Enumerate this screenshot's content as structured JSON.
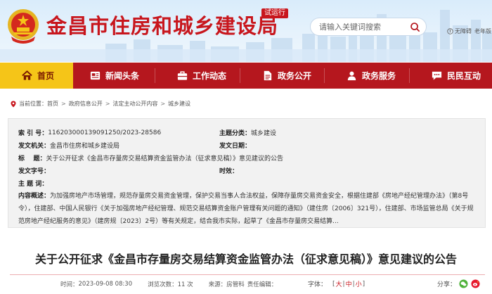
{
  "header": {
    "site_title": "金昌市住房和城乡建设局",
    "trial_badge": "试运行",
    "search_placeholder": "请输入关键词搜索",
    "accessibility_label": "无障碍",
    "old_version_label": "老年版"
  },
  "nav": {
    "items": [
      {
        "label": "首页",
        "active": true,
        "icon": "home-icon"
      },
      {
        "label": "新闻头条",
        "active": false,
        "icon": "news-icon"
      },
      {
        "label": "工作动态",
        "active": false,
        "icon": "briefcase-icon"
      },
      {
        "label": "政务公开",
        "active": false,
        "icon": "document-icon"
      },
      {
        "label": "政务服务",
        "active": false,
        "icon": "service-icon"
      },
      {
        "label": "民民互动",
        "active": false,
        "icon": "chat-icon"
      }
    ]
  },
  "breadcrumb": {
    "location_label": "当前位置：",
    "items": [
      "首页",
      "政府信息公开",
      "法定主动公开内容",
      "城乡建设"
    ]
  },
  "info": {
    "index_label": "索 引 号：",
    "index_value": "116203000139091250/2023-28586",
    "topic_label": "主题分类：",
    "topic_value": "城乡建设",
    "issuer_label": "发文机关：",
    "issuer_value": "金昌市住房和城乡建设局",
    "issue_date_label": "发文日期：",
    "issue_date_value": "",
    "title_label": "标    题：",
    "title_value": "关于公开征求《金昌市存量房交易结算资金监管办法（征求意见稿）》意见建议的公告",
    "doc_no_label": "发文字号：",
    "doc_no_value": "",
    "validity_label": "时效：",
    "validity_value": "",
    "keywords_label": "主 题 词：",
    "keywords_value": "",
    "summary_label": "内容概述：",
    "summary_value": "为加强房地产市场管理，规范存量房交易资金管理，保护交易当事人合法权益，保障存量房交易资金安全，根据住建部《房地产经纪管理办法》（第8号令），住建部、中国人民银行《关于加强房地产经纪管理、规范交易结算资金账户管理有关问题的通知》（建住房〔2006〕321号），住建部、市场监管总局《关于规范房地产经纪服务的意见》（建房规〔2023〕2号）等有关规定，结合我市实际，起草了《金昌市存量房交易结算..."
  },
  "article": {
    "title": "关于公开征求《金昌市存量房交易结算资金监管办法（征求意见稿）》意见建议的公告",
    "time_label": "时间：",
    "time_value": "2023-09-08 08:30",
    "views_label": "浏览次数：",
    "views_value": "11 次",
    "source_label": "来源：",
    "source_value": "房管科",
    "editor_label": "责任编辑：",
    "editor_value": "",
    "font_label": "字体：",
    "font_large": "大",
    "font_medium": "中",
    "font_small": "小",
    "share_label": "分享："
  },
  "colors": {
    "brand_red": "#c8161d",
    "nav_red": "#b5171e",
    "nav_active": "#f5c518"
  }
}
